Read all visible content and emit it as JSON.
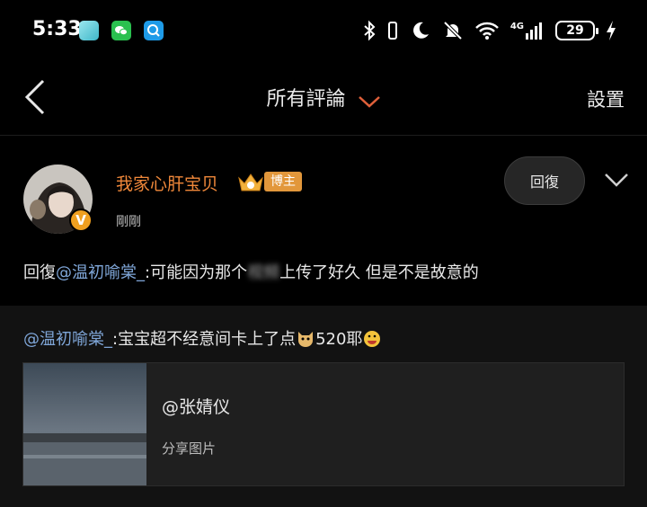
{
  "status_bar": {
    "time": "5:33",
    "battery": "29",
    "network": "4G",
    "icons": [
      "notification-app-icon",
      "wechat-icon",
      "search-app-icon",
      "bluetooth-icon",
      "moon-icon",
      "mute-icon",
      "wifi-icon",
      "signal-icon",
      "charging-icon"
    ]
  },
  "header": {
    "title": "所有評論",
    "settings_label": "設置",
    "accent": "#e0603a"
  },
  "post": {
    "username": "我家心肝宝贝",
    "badge": "博主",
    "verified_label": "V",
    "timestamp": "剛剛",
    "reply_button": "回復",
    "comment_prefix": "回復",
    "comment_mention": "@温初喻棠_",
    "comment_text_a": ":可能因为那个",
    "comment_text_blur": "视频",
    "comment_text_b": "上传了好久 但是不是故意的"
  },
  "quote": {
    "mention": "@温初喻棠_",
    "text_a": ":宝宝超不经意间卡上了点",
    "text_b": "520耶",
    "card_title": "@张婧仪",
    "card_subtitle": "分享图片"
  },
  "colors": {
    "username": "#f0883a",
    "mention": "#7fa6d8",
    "badge_bg": "#e2973b"
  }
}
